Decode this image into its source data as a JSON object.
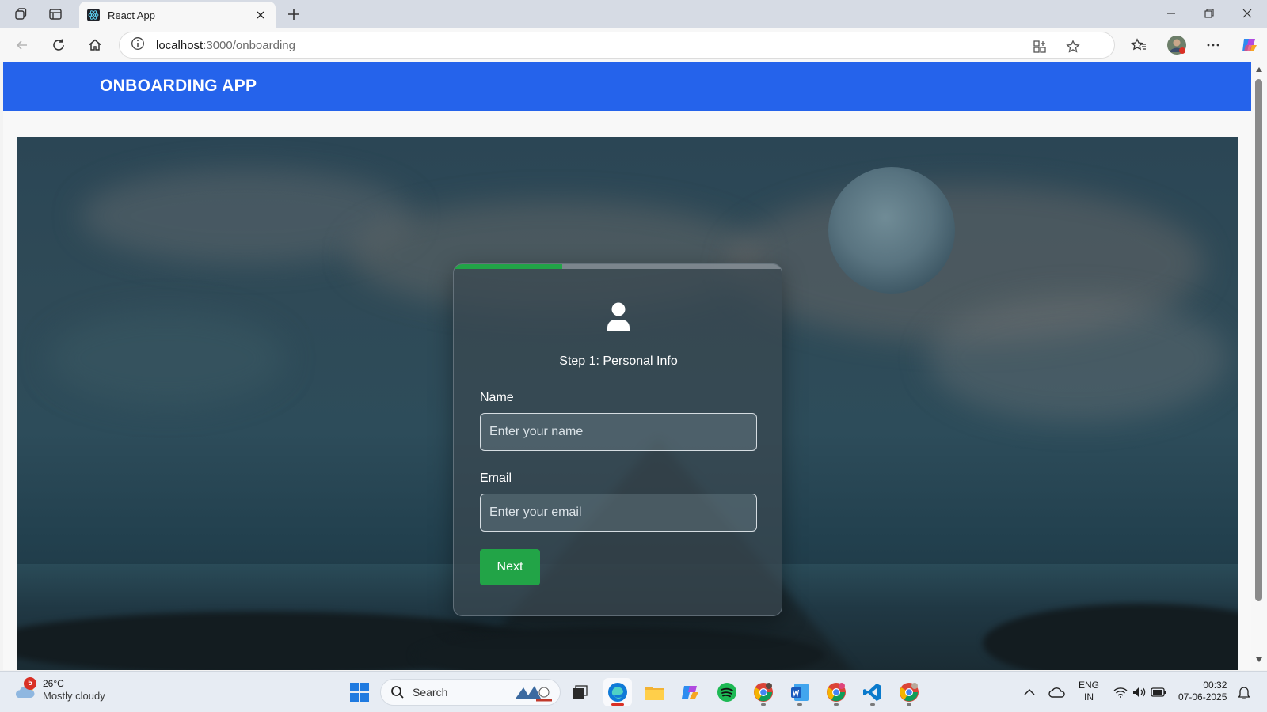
{
  "browser": {
    "tab_title": "React App",
    "url_host": "localhost",
    "url_path": ":3000/onboarding"
  },
  "app": {
    "header_title": "ONBOARDING APP"
  },
  "onboarding": {
    "progress_fraction": 0.33,
    "icon": "user-icon",
    "step_title": "Step 1: Personal Info",
    "name_label": "Name",
    "name_placeholder": "Enter your name",
    "name_value": "",
    "email_label": "Email",
    "email_placeholder": "Enter your email",
    "email_value": "",
    "next_label": "Next"
  },
  "taskbar": {
    "weather_badge": "5",
    "temperature": "26°C",
    "condition": "Mostly cloudy",
    "search_label": "Search",
    "lang_top": "ENG",
    "lang_bottom": "IN",
    "time": "00:32",
    "date": "07-06-2025"
  },
  "colors": {
    "header_blue": "#2563eb",
    "progress_green": "#22a447",
    "button_green": "#22a447"
  }
}
